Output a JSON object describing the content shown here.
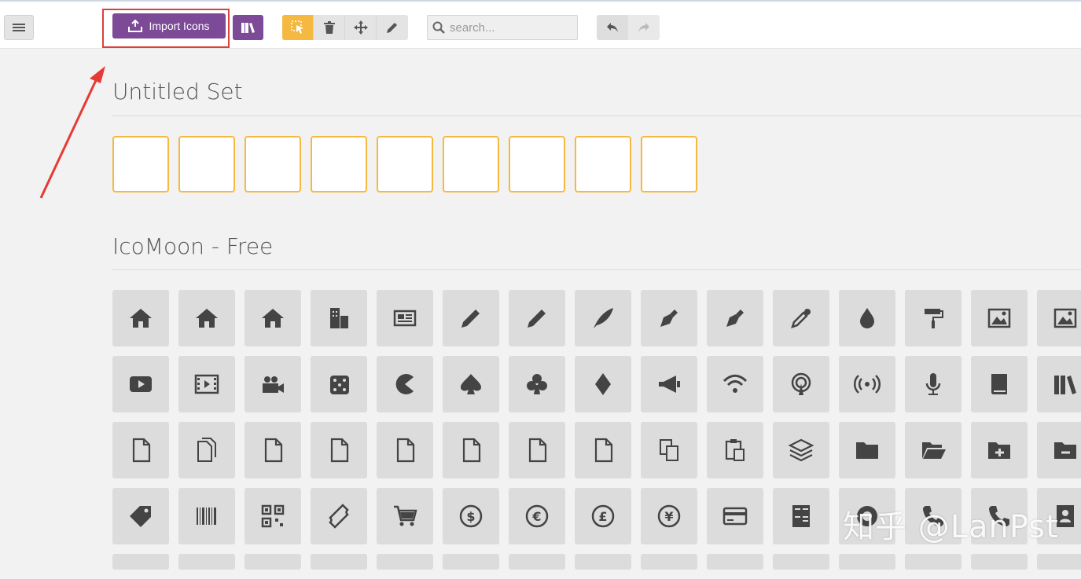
{
  "toolbar": {
    "import_label": "Import Icons",
    "search_placeholder": "search...",
    "accent": "#7c4a96",
    "tool_active_color": "#f5b942"
  },
  "sets": {
    "untitled": {
      "title": "Untitled Set",
      "empty_slots": 9
    },
    "icomoon": {
      "title": "IcoMoon - Free"
    }
  },
  "icon_rows": [
    [
      "home-icon",
      "home2-icon",
      "home3-icon",
      "office-icon",
      "newspaper-icon",
      "pencil-icon",
      "pencil2-icon",
      "quill-icon",
      "pen-icon",
      "blog-icon",
      "eyedropper-icon",
      "droplet-icon",
      "paint-format-icon",
      "image-icon",
      "images-icon"
    ],
    [
      "youtube-icon",
      "film-icon",
      "video-camera-icon",
      "dice-icon",
      "pacman-icon",
      "spades-icon",
      "clubs-icon",
      "diamonds-icon",
      "bullhorn-icon",
      "wifi-icon",
      "podcast-icon",
      "feed-icon",
      "mic-icon",
      "book-icon",
      "books-icon"
    ],
    [
      "file-empty-icon",
      "files-empty-icon",
      "file-text-icon",
      "file-picture-icon",
      "file-music-icon",
      "file-play-icon",
      "file-video-icon",
      "file-zip-icon",
      "copy-icon",
      "paste-icon",
      "stack-icon",
      "folder-icon",
      "folder-open-icon",
      "folder-plus-icon",
      "folder-minus-icon"
    ],
    [
      "price-tags-icon",
      "barcode-icon",
      "qrcode-icon",
      "ticket-icon",
      "cart-icon",
      "coin-dollar-icon",
      "coin-euro-icon",
      "coin-pound-icon",
      "coin-yen-icon",
      "credit-card-icon",
      "calculator-icon",
      "lifebuoy-icon",
      "phone-icon",
      "phone-hang-up-icon",
      "address-book-icon"
    ]
  ],
  "watermark": "知乎 @LanPst"
}
